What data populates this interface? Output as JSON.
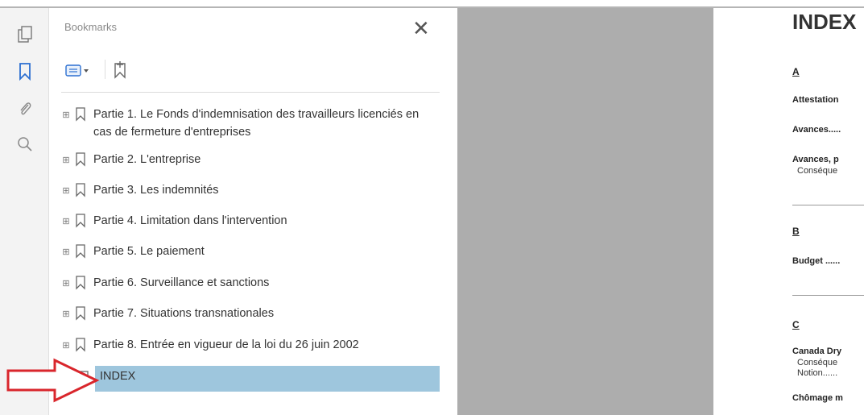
{
  "panel": {
    "title": "Bookmarks",
    "close_label": "✕",
    "items": [
      {
        "label": "Partie 1. Le Fonds d'indemnisation des travailleurs licenciés en cas de fermeture d'entreprises"
      },
      {
        "label": "Partie 2. L'entreprise"
      },
      {
        "label": "Partie 3. Les indemnités"
      },
      {
        "label": "Partie 4. Limitation dans l'intervention"
      },
      {
        "label": "Partie 5. Le paiement"
      },
      {
        "label": "Partie 6. Surveillance et sanctions"
      },
      {
        "label": "Partie 7. Situations transnationales"
      },
      {
        "label": "Partie 8. Entrée en vigueur de la loi du 26 juin 2002"
      }
    ],
    "selected_item": "INDEX"
  },
  "document": {
    "title": "INDEX",
    "sections": [
      {
        "letter": "A",
        "entries": [
          "Attestation",
          "Avances.....",
          "Avances, p"
        ],
        "subs": [
          "Conséque"
        ]
      },
      {
        "letter": "B",
        "entries": [
          "Budget ......"
        ],
        "subs": []
      },
      {
        "letter": "C",
        "entries": [
          "Canada Dry",
          "Chômage m"
        ],
        "subs": [
          "Conséque",
          "Notion......"
        ]
      }
    ]
  },
  "colors": {
    "selection": "#9ec6dd",
    "gray_area": "#adadad",
    "arrow": "#d9262c",
    "rail_active": "#2c6fd1"
  },
  "icons": {
    "rail": [
      "page-thumbnails-icon",
      "bookmark-icon",
      "attachment-icon",
      "search-icon"
    ],
    "toolbar": [
      "options-menu-icon",
      "new-bookmark-icon"
    ]
  }
}
